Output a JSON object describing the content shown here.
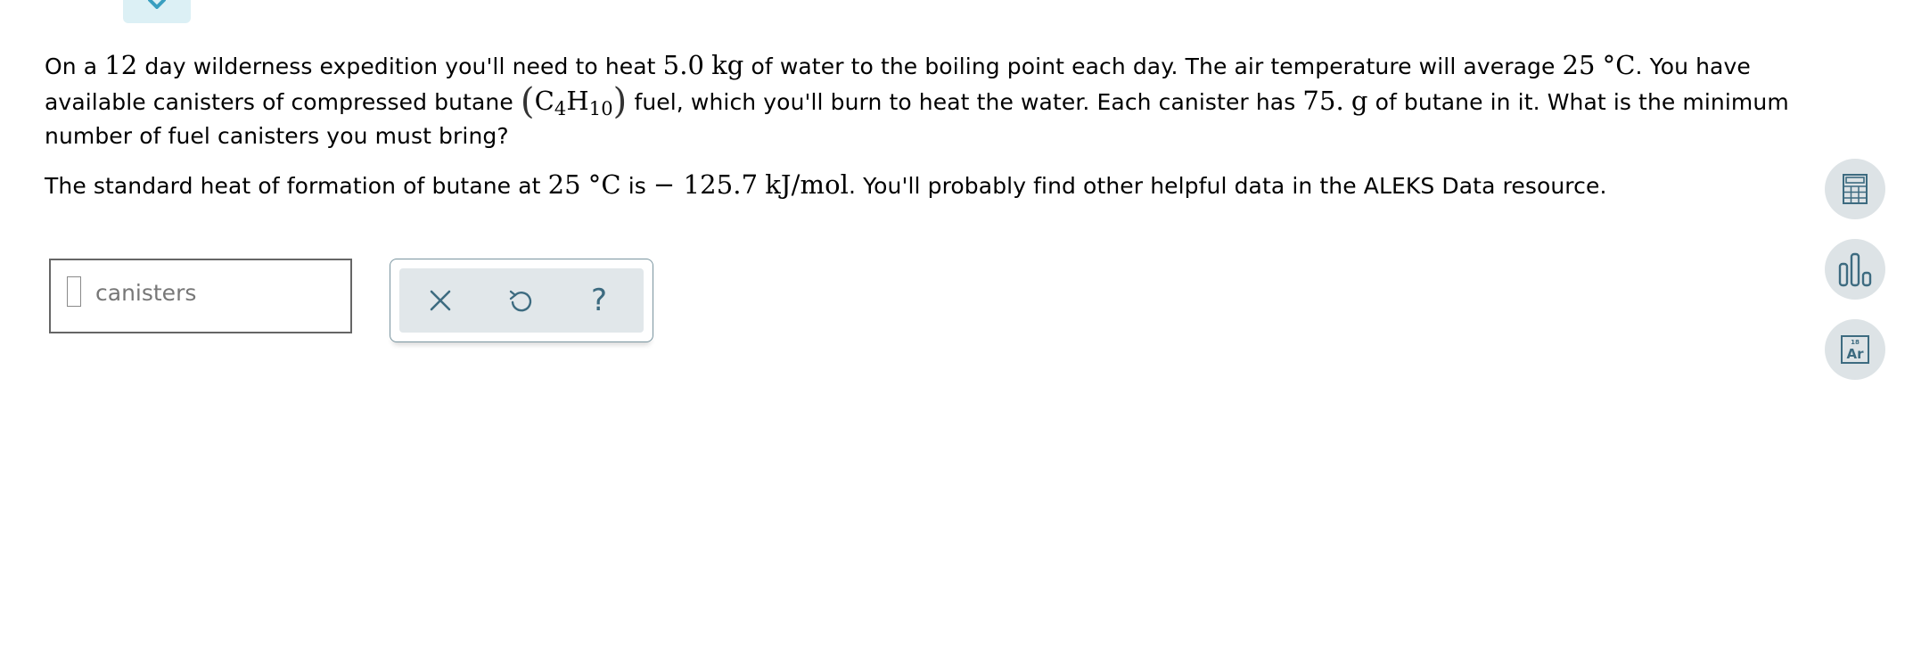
{
  "question": {
    "p1": {
      "t1": "On a",
      "days": "12",
      "t2": "day wilderness expedition you'll need to heat",
      "mass": "5.0",
      "mass_unit": "kg",
      "t3": "of water to the boiling point each day. The air temperature will average",
      "temp": "25",
      "temp_unit": "°C",
      "t4": ". You have available canisters of compressed butane",
      "formula_c": "C",
      "formula_c_sub": "4",
      "formula_h": "H",
      "formula_h_sub": "10",
      "t5": "fuel, which you'll burn to heat the water. Each canister has",
      "canister_mass": "75.",
      "canister_unit": "g",
      "t6": "of butane in it. What is the minimum number of fuel canisters you must bring?"
    },
    "p2": {
      "t1": "The standard heat of formation of butane at",
      "temp": "25",
      "temp_unit": "°C",
      "t2": "is",
      "value": "− 125.7",
      "unit": "kJ/mol",
      "t3": ". You'll probably find other helpful data in the ALEKS Data resource."
    }
  },
  "answer": {
    "value": "",
    "unit_label": "canisters"
  },
  "tools": {
    "help_glyph": "?"
  },
  "periodic_icon": {
    "number": "18",
    "symbol": "Ar"
  },
  "colors": {
    "icon": "#3d6b80",
    "tool_bg": "#e1e7ea",
    "side_bg": "#dde3e6",
    "tab_bg": "#dcf0f5",
    "tab_accent": "#3a9fc0"
  }
}
